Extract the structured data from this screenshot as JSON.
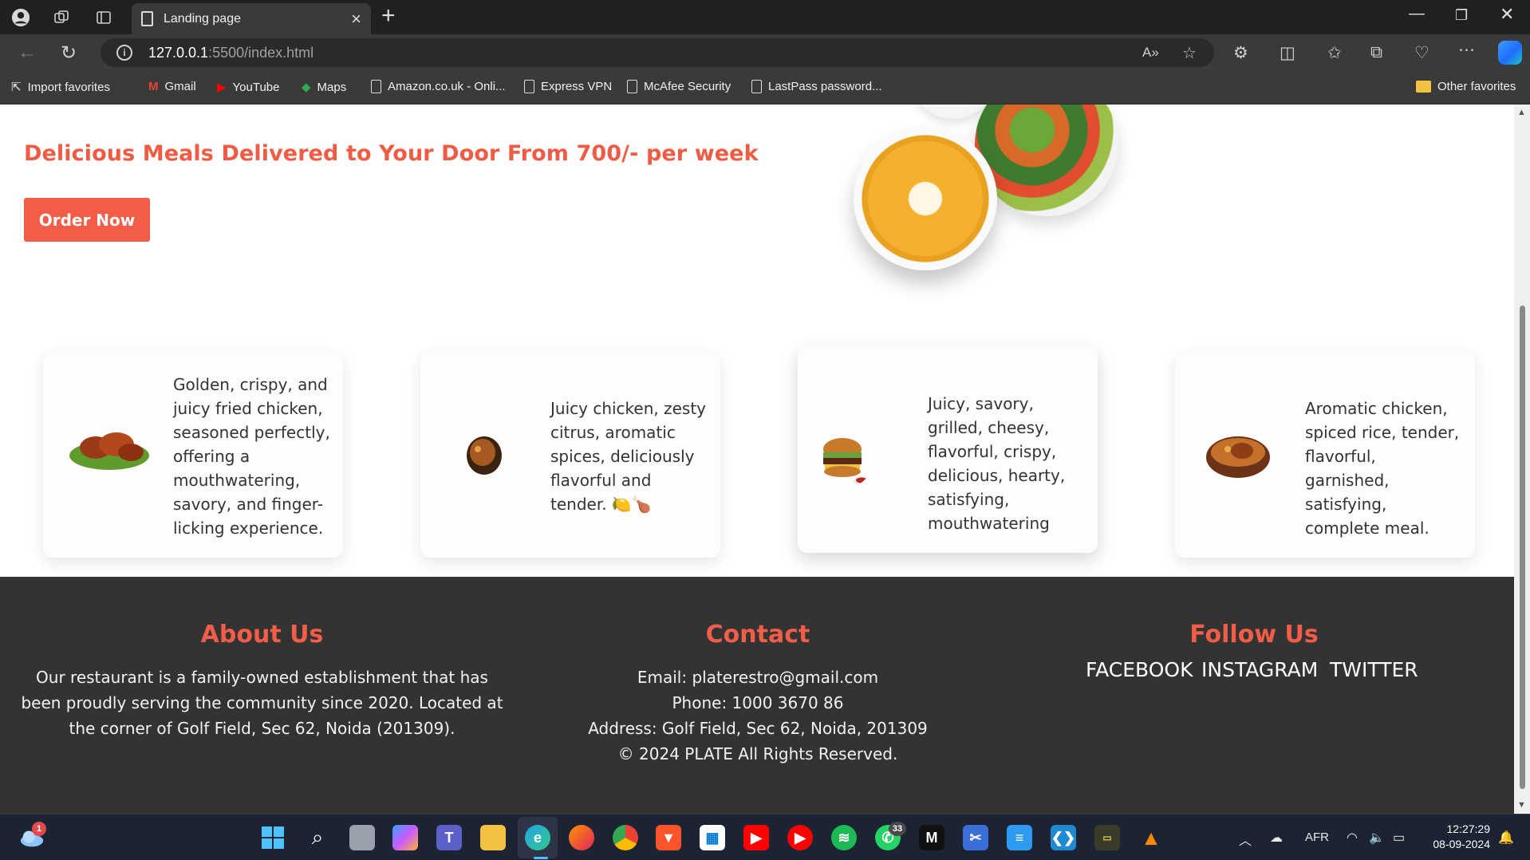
{
  "browser": {
    "tab_title": "Landing page",
    "url_host": "127.0.0.1",
    "url_path": ":5500/index.html",
    "favorites": [
      "Import favorites",
      "Gmail",
      "YouTube",
      "Maps",
      "Amazon.co.uk - Onli...",
      "Express VPN",
      "McAfee Security",
      "LastPass password..."
    ],
    "other_favorites": "Other favorites"
  },
  "hero": {
    "title": "Delicious Meals Delivered to Your Door From 700/- per week",
    "order_button": "Order Now"
  },
  "cards": [
    {
      "text": "Golden, crispy, and juicy fried chicken, seasoned perfectly, offering a mouthwatering, savory, and finger-licking experience.",
      "image": "fried-chicken"
    },
    {
      "text": "Juicy chicken, zesty citrus, aromatic spices, deliciously flavorful and tender. 🍋🍗",
      "image": "roast-chicken"
    },
    {
      "text": "Juicy, savory, grilled, cheesy, flavorful, crispy, delicious, hearty, satisfying, mouthwatering",
      "image": "burger"
    },
    {
      "text": "Aromatic chicken, spiced rice, tender, flavorful, garnished, satisfying, complete meal.",
      "image": "chicken-biryani"
    }
  ],
  "footer": {
    "about": {
      "heading": "About Us",
      "text": "Our restaurant is a family-owned establishment that has been proudly serving the community since 2020. Located at the corner of Golf Field, Sec 62, Noida (201309)."
    },
    "contact": {
      "heading": "Contact",
      "email": "Email: platerestro@gmail.com",
      "phone": "Phone: 1000 3670 86",
      "address": "Address: Golf Field, Sec 62, Noida, 201309",
      "copyright": "© 2024 PLATE All Rights Reserved."
    },
    "follow": {
      "heading": "Follow Us",
      "links": [
        "FACEBOOK",
        "INSTAGRAM",
        "TWITTER"
      ]
    }
  },
  "taskbar": {
    "language": "AFR",
    "time": "12:27:29",
    "date": "08-09-2024",
    "weather_badge": "1",
    "whatsapp_badge": "33"
  },
  "colors": {
    "accent": "#f25d48",
    "footer_bg": "#333333"
  }
}
